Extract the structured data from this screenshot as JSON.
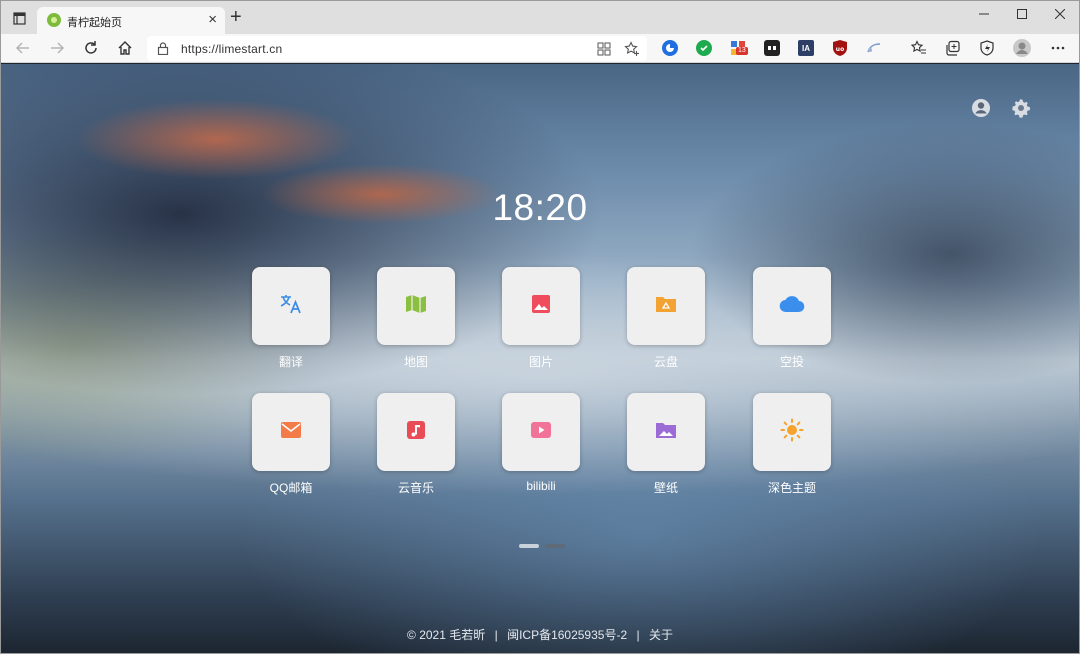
{
  "browser": {
    "tab_title": "青柠起始页",
    "url": "https://limestart.cn",
    "new_tab_symbol": "+",
    "tab_close_symbol": "×",
    "extension_badge": "13",
    "extension_ia_label": "IA"
  },
  "page": {
    "time": "18:20",
    "tiles_row1": [
      {
        "label": "翻译",
        "icon": "translate-icon",
        "color": "#3d8de6"
      },
      {
        "label": "地图",
        "icon": "map-icon",
        "color": "#8bbf3f"
      },
      {
        "label": "图片",
        "icon": "image-icon",
        "color": "#ef4c5e"
      },
      {
        "label": "云盘",
        "icon": "cloud-drive-icon",
        "color": "#f3a334"
      },
      {
        "label": "空投",
        "icon": "cloud-icon",
        "color": "#3b8fec"
      }
    ],
    "tiles_row2": [
      {
        "label": "QQ邮箱",
        "icon": "mail-icon",
        "color": "#f37b4a"
      },
      {
        "label": "云音乐",
        "icon": "music-icon",
        "color": "#e84d55"
      },
      {
        "label": "bilibili",
        "icon": "play-icon",
        "color": "#f27398"
      },
      {
        "label": "壁纸",
        "icon": "wallpaper-icon",
        "color": "#9b6bd6"
      },
      {
        "label": "深色主题",
        "icon": "sun-icon",
        "color": "#f6a22c"
      }
    ],
    "pagination": {
      "pages": 2,
      "active": 1
    },
    "footer": {
      "copyright": "© 2021 毛若昕",
      "separator": "|",
      "icp": "闽ICP备16025935号-2",
      "about": "关于"
    }
  },
  "colors": {
    "dot_active": "#c9d2db",
    "dot_inactive": "#5f6b78"
  }
}
